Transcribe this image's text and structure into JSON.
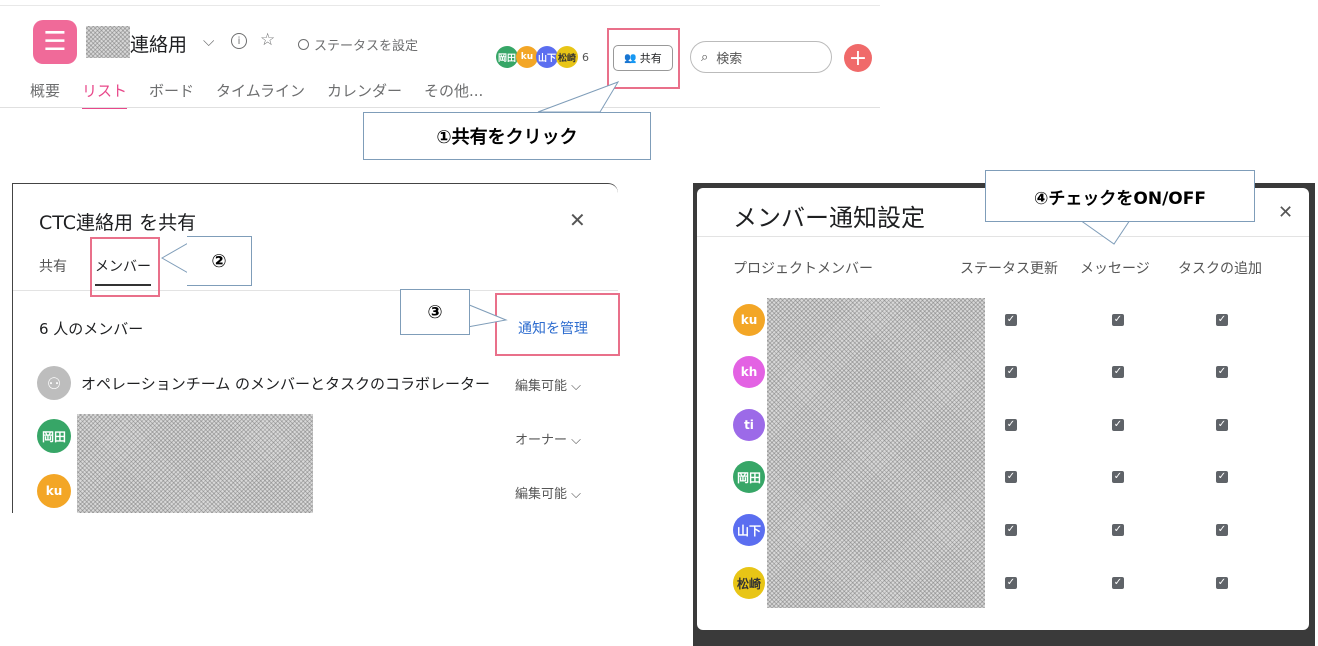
{
  "top": {
    "project_title": "連絡用",
    "status_button": "ステータスを設定",
    "avatars": [
      "岡田",
      "ku",
      "山下",
      "松崎"
    ],
    "member_count": "6",
    "share_label": "共有",
    "search_placeholder": "検索",
    "tabs": [
      "概要",
      "リスト",
      "ボード",
      "タイムライン",
      "カレンダー",
      "その他..."
    ],
    "active_tab": "リスト"
  },
  "callouts": {
    "step1": "①共有をクリック",
    "step2": "②",
    "step3": "③",
    "step4": "④チェックをON/OFF"
  },
  "share_dialog": {
    "title": "CTC連絡用 を共有",
    "tabs": [
      "共有",
      "メンバー"
    ],
    "member_count": "6 人のメンバー",
    "manage_link": "通知を管理",
    "team_row": "オペレーションチーム のメンバーとタスクのコラボレーター",
    "rows": [
      {
        "avatar": "",
        "role": "編集可能"
      },
      {
        "avatar": "岡田",
        "role": "オーナー"
      },
      {
        "avatar": "ku",
        "role": "編集可能"
      }
    ]
  },
  "notify_dialog": {
    "title": "メンバー通知設定",
    "columns": [
      "プロジェクトメンバー",
      "ステータス更新",
      "メッセージ",
      "タスクの追加"
    ],
    "members": [
      "ku",
      "kh",
      "ti",
      "岡田",
      "山下",
      "松崎"
    ],
    "checked": "✓"
  },
  "colors": {
    "brand": "#f06a99",
    "highlight": "#e9708a",
    "link": "#2d6ccf",
    "avatar_ku": "#f3a626",
    "avatar_kh": "#e362e3",
    "avatar_ti": "#9c6ae8",
    "avatar_okada": "#37a667",
    "avatar_yamashita": "#5b6ef0",
    "avatar_matsuzaki": "#e8c516"
  }
}
